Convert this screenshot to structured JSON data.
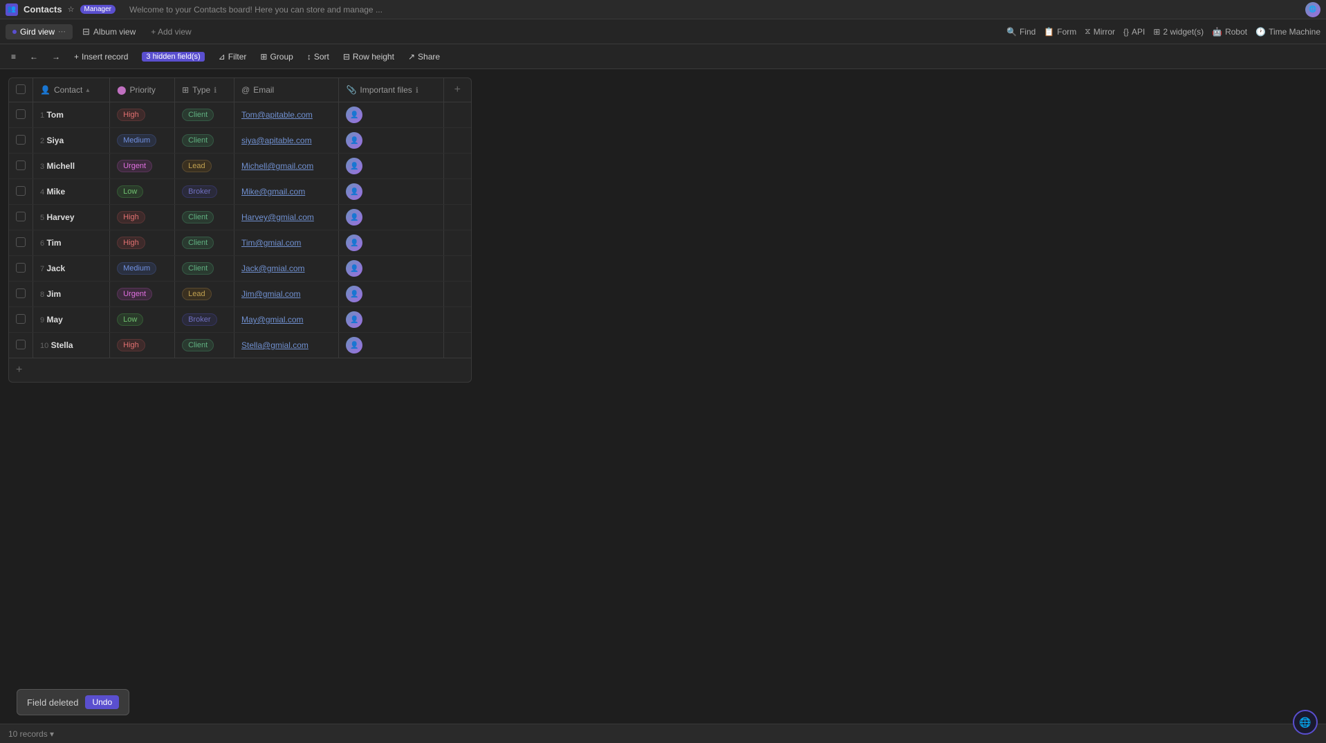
{
  "app": {
    "title": "Contacts",
    "badge": "Manager",
    "banner": "Welcome to your Contacts board! Here you can store and manage ..."
  },
  "views": {
    "active": "Gird view",
    "tabs": [
      {
        "label": "Gird view",
        "icon": "⊞",
        "active": true
      },
      {
        "label": "Album view",
        "icon": "⊟",
        "active": false
      }
    ],
    "add_label": "+ Add view",
    "right_items": [
      "Find",
      "Form",
      "Mirror",
      "API",
      "2 widget(s)",
      "Robot",
      "Time Machine"
    ]
  },
  "toolbar": {
    "insert_record": "Insert record",
    "hidden_fields": "3 hidden field(s)",
    "filter": "Filter",
    "group": "Group",
    "sort": "Sort",
    "row_height": "Row height",
    "share": "Share"
  },
  "table": {
    "columns": [
      {
        "label": "Contact",
        "icon": "👤"
      },
      {
        "label": "Priority",
        "icon": "⬤"
      },
      {
        "label": "Type",
        "icon": "⊞"
      },
      {
        "label": "Email",
        "icon": "@"
      },
      {
        "label": "Important files",
        "icon": "📎"
      }
    ],
    "rows": [
      {
        "num": 1,
        "contact": "Tom",
        "priority": "High",
        "priority_class": "badge-high",
        "type": "Client",
        "type_class": "type-client",
        "email": "Tom@apitable.com",
        "has_file": true
      },
      {
        "num": 2,
        "contact": "Siya",
        "priority": "Medium",
        "priority_class": "badge-medium",
        "type": "Client",
        "type_class": "type-client",
        "email": "siya@apitable.com",
        "has_file": true
      },
      {
        "num": 3,
        "contact": "Michell",
        "priority": "Urgent",
        "priority_class": "badge-urgent",
        "type": "Lead",
        "type_class": "type-lead",
        "email": "Michell@gmail.com",
        "has_file": true
      },
      {
        "num": 4,
        "contact": "Mike",
        "priority": "Low",
        "priority_class": "badge-low",
        "type": "Broker",
        "type_class": "type-broker",
        "email": "Mike@gmail.com",
        "has_file": true
      },
      {
        "num": 5,
        "contact": "Harvey",
        "priority": "High",
        "priority_class": "badge-high",
        "type": "Client",
        "type_class": "type-client",
        "email": "Harvey@gmial.com",
        "has_file": true
      },
      {
        "num": 6,
        "contact": "Tim",
        "priority": "High",
        "priority_class": "badge-high",
        "type": "Client",
        "type_class": "type-client",
        "email": "Tim@gmial.com",
        "has_file": true
      },
      {
        "num": 7,
        "contact": "Jack",
        "priority": "Medium",
        "priority_class": "badge-medium",
        "type": "Client",
        "type_class": "type-client",
        "email": "Jack@gmial.com",
        "has_file": true
      },
      {
        "num": 8,
        "contact": "Jim",
        "priority": "Urgent",
        "priority_class": "badge-urgent",
        "type": "Lead",
        "type_class": "type-lead",
        "email": "Jim@gmial.com",
        "has_file": true
      },
      {
        "num": 9,
        "contact": "May",
        "priority": "Low",
        "priority_class": "badge-low",
        "type": "Broker",
        "type_class": "type-broker",
        "email": "May@gmial.com",
        "has_file": true
      },
      {
        "num": 10,
        "contact": "Stella",
        "priority": "High",
        "priority_class": "badge-high",
        "type": "Client",
        "type_class": "type-client",
        "email": "Stella@gmial.com",
        "has_file": true
      }
    ],
    "record_count": "10 records"
  },
  "toast": {
    "message": "Field deleted",
    "undo_label": "Undo"
  },
  "icons": {
    "grid": "⊞",
    "album": "⊟",
    "find": "🔍",
    "form": "📋",
    "mirror": "⧖",
    "api": "{}",
    "robot": "🤖",
    "time_machine": "🕐",
    "chevron_down": "▾",
    "hamburger": "≡",
    "back": "←",
    "forward": "→"
  }
}
